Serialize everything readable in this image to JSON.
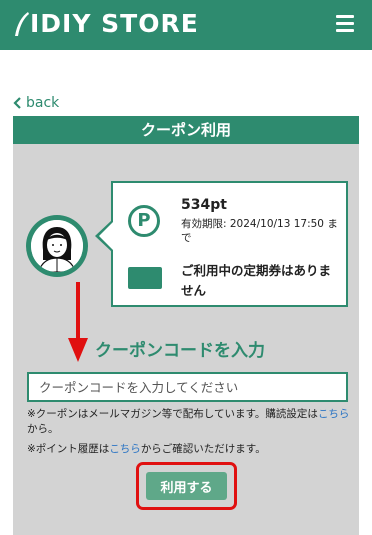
{
  "header": {
    "brand": "IDIY STORE",
    "colors": {
      "brand": "#2e8b6f",
      "highlight": "#e01010",
      "link": "#2a74c4"
    }
  },
  "nav": {
    "back_label": "back"
  },
  "panel": {
    "title": "クーポン利用",
    "points": "534pt",
    "expiry": "有効期限: 2024/10/13 17:50 まで",
    "pass_status": "ご利用中の定期券はありません",
    "point_icon_letter": "P"
  },
  "coupon": {
    "section_title": "クーポンコードを入力",
    "input_placeholder": "クーポンコードを入力してください",
    "input_value": "",
    "note1_prefix": "※クーポンはメールマガジン等で配布しています。購読設定は",
    "note1_link": "こちら",
    "note1_suffix": "から。",
    "note2_prefix": "※ポイント履歴は",
    "note2_link": "こちら",
    "note2_suffix": "からご確認いただけます。",
    "submit_label": "利用する"
  }
}
